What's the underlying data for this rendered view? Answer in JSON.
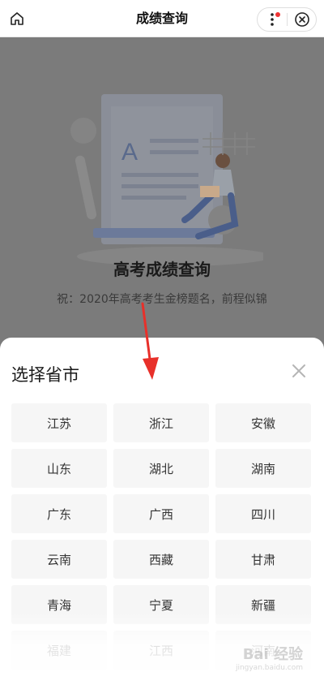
{
  "navbar": {
    "title": "成绩查询",
    "home_icon": "home-icon",
    "more_icon": "more-dots-icon",
    "close_icon": "close-circle-icon",
    "badge_color": "#ee3333"
  },
  "hero": {
    "title": "高考成绩查询",
    "subtitle": "祝：2020年高考考生金榜题名，前程似锦",
    "illustration_letter": "A"
  },
  "sheet": {
    "title": "选择省市",
    "close_icon": "close-icon",
    "provinces": [
      {
        "label": "江苏"
      },
      {
        "label": "浙江"
      },
      {
        "label": "安徽"
      },
      {
        "label": "山东"
      },
      {
        "label": "湖北"
      },
      {
        "label": "湖南"
      },
      {
        "label": "广东"
      },
      {
        "label": "广西"
      },
      {
        "label": "四川"
      },
      {
        "label": "云南"
      },
      {
        "label": "西藏"
      },
      {
        "label": "甘肃"
      },
      {
        "label": "青海"
      },
      {
        "label": "宁夏"
      },
      {
        "label": "新疆"
      },
      {
        "label": "福建"
      },
      {
        "label": "江西"
      },
      {
        "label": "河南"
      }
    ]
  },
  "annotation": {
    "arrow_color": "#e8302a"
  },
  "watermark": {
    "main": "Bai 经验",
    "sub": "jingyan.baidu.com"
  }
}
